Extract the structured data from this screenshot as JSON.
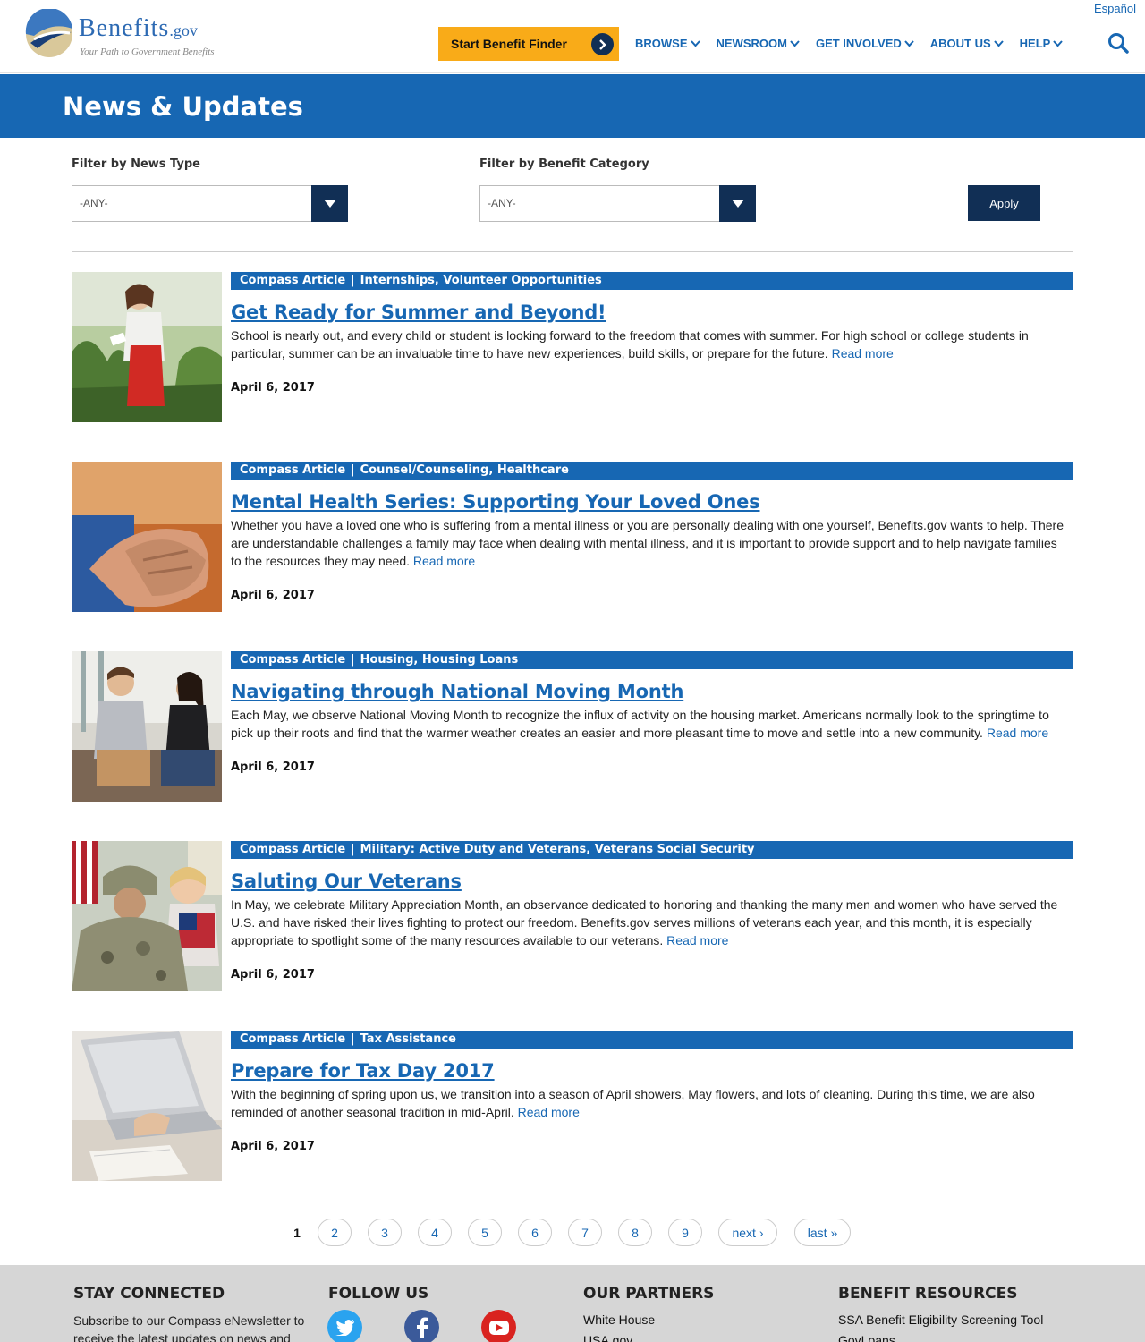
{
  "header": {
    "espanol": "Español",
    "logo_name": "Benefits",
    "logo_gov": ".gov",
    "logo_tagline": "Your Path to Government Benefits",
    "finder_label": "Start Benefit Finder",
    "nav": [
      "BROWSE",
      "NEWSROOM",
      "GET INVOLVED",
      "ABOUT US",
      "HELP"
    ]
  },
  "banner": {
    "title": "News & Updates"
  },
  "filters": {
    "news_type_label": "Filter by News Type",
    "news_type_value": "-ANY-",
    "category_label": "Filter by Benefit Category",
    "category_value": "-ANY-",
    "apply": "Apply"
  },
  "articles": [
    {
      "type": "Compass Article",
      "categories": "Internships, Volunteer Opportunities",
      "title": "Get Ready for Summer and Beyond!",
      "body": "School is nearly out, and every child or student is looking forward to the freedom that comes with summer. For high school or college students in particular, summer can be an invaluable time to have new experiences, build skills, or prepare for the future.",
      "read_more": "Read more",
      "date": "April 6, 2017"
    },
    {
      "type": "Compass Article",
      "categories": "Counsel/Counseling, Healthcare",
      "title": "Mental Health Series: Supporting Your Loved Ones",
      "body": "Whether you have a loved one who is suffering from a mental illness or you are personally dealing with one yourself, Benefits.gov wants to help. There are understandable challenges a family may face when dealing with mental illness, and it is important to provide support and to help navigate families to the resources they may need.",
      "read_more": "Read more",
      "date": "April 6, 2017"
    },
    {
      "type": "Compass Article",
      "categories": "Housing, Housing Loans",
      "title": "Navigating through National Moving Month",
      "body": "Each May, we observe National Moving Month to recognize the influx of activity on the housing market. Americans normally look to the springtime to pick up their roots and find that the warmer weather creates an easier and more pleasant time to move and settle into a new community.",
      "read_more": "Read more",
      "date": "April 6, 2017"
    },
    {
      "type": "Compass Article",
      "categories": "Military: Active Duty and Veterans, Veterans Social Security",
      "title": "Saluting Our Veterans",
      "body": "In May, we celebrate Military Appreciation Month, an observance dedicated to honoring and thanking the many men and women who have served the U.S. and have risked their lives fighting to protect our freedom. Benefits.gov serves millions of veterans each year, and this month, it is especially appropriate to spotlight some of the many resources available to our veterans.",
      "read_more": "Read more",
      "date": "April 6, 2017"
    },
    {
      "type": "Compass Article",
      "categories": "Tax Assistance",
      "title": "Prepare for Tax Day 2017",
      "body": "With the beginning of spring upon us, we transition into a season of April showers, May flowers, and lots of cleaning. During this time, we are also reminded of another seasonal tradition in mid-April.",
      "read_more": "Read more",
      "date": "April 6, 2017"
    }
  ],
  "pagination": {
    "current": "1",
    "pages": [
      "2",
      "3",
      "4",
      "5",
      "6",
      "7",
      "8",
      "9"
    ],
    "next": "next ›",
    "last": "last »"
  },
  "footer": {
    "stay_connected": "STAY CONNECTED",
    "stay_text": "Subscribe to our Compass eNewsletter to receive the latest updates on news and",
    "follow_us": "FOLLOW US",
    "partners": "OUR PARTNERS",
    "partner_links": [
      "White House",
      "USA.gov"
    ],
    "resources": "BENEFIT RESOURCES",
    "resource_links": [
      "SSA Benefit Eligibility Screening Tool",
      "GovLoans"
    ]
  },
  "colors": {
    "brand_blue": "#1767b3",
    "navy": "#112f55",
    "finder_orange": "#f9ab18",
    "footer_gray": "#d6d6d6"
  },
  "icons": [
    "chevron-down-icon",
    "arrow-right-icon",
    "search-icon",
    "twitter-icon",
    "facebook-icon",
    "youtube-icon"
  ]
}
